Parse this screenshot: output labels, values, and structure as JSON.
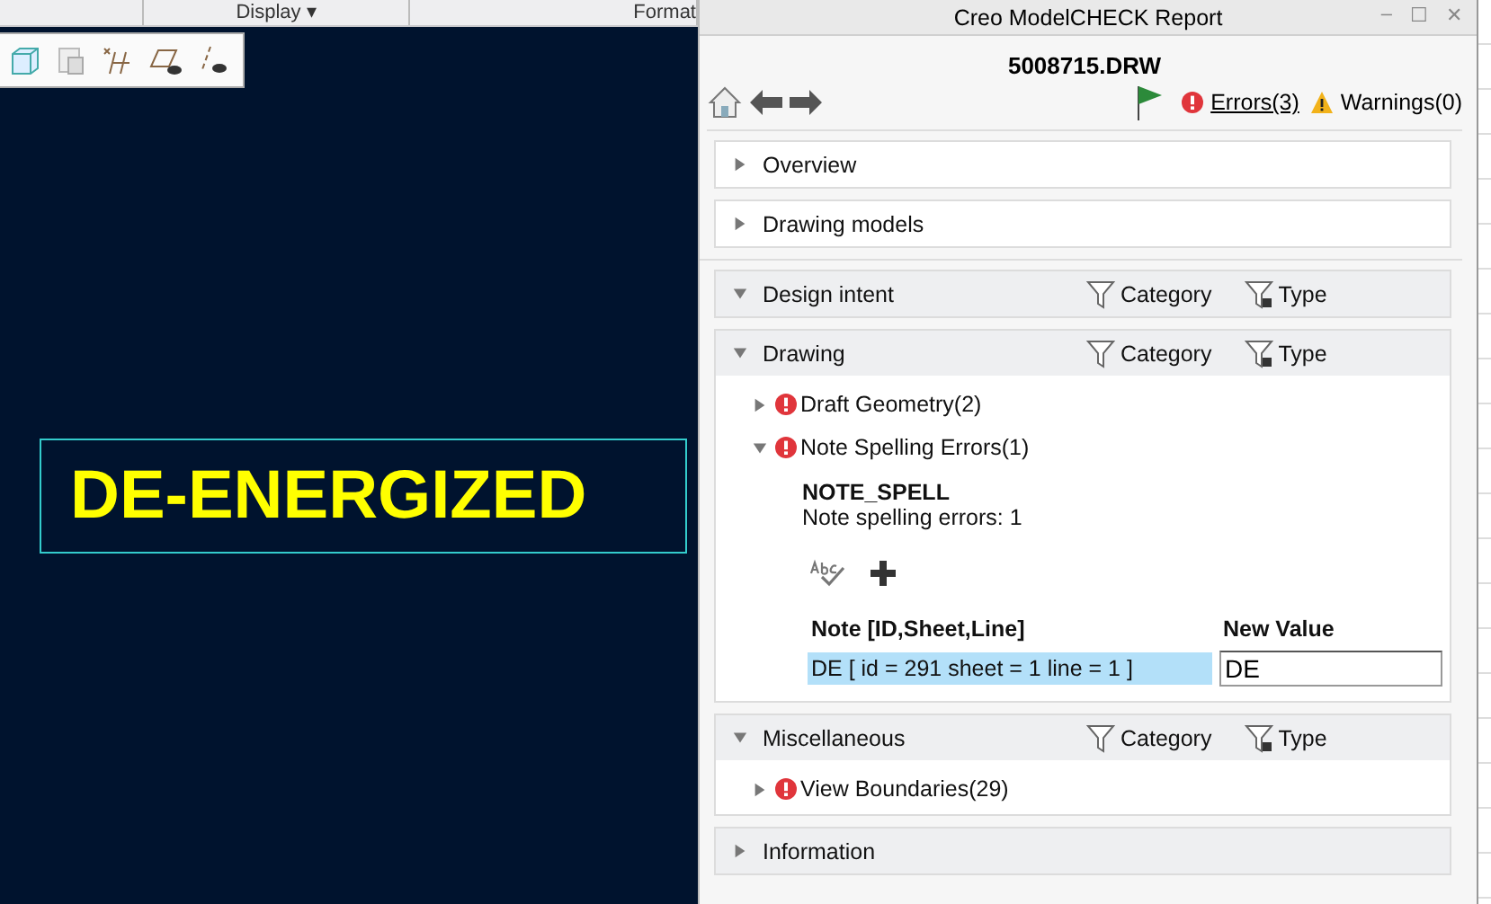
{
  "ribbon": {
    "tabs": [
      {
        "label": "Display",
        "caret": "▾"
      },
      {
        "label": "Format"
      }
    ]
  },
  "canvas": {
    "note": "DE-ENERGIZED"
  },
  "report": {
    "window": {
      "title": "Creo ModelCHECK Report",
      "controls": [
        "–",
        "☐",
        "✕"
      ]
    },
    "filename": "5008715.DRW",
    "errors": "Errors(3)",
    "warnings": "Warnings(0)",
    "sections": [
      {
        "kind": "summary",
        "title": "Overview",
        "expanded": false
      },
      {
        "kind": "summary",
        "title": "Drawing models",
        "expanded": false
      },
      {
        "kind": "category",
        "title": "Design intent",
        "expanded": true,
        "filters": [
          "Category",
          "Type"
        ]
      },
      {
        "kind": "category",
        "title": "Drawing",
        "expanded": true,
        "filters": [
          "Category",
          "Type"
        ],
        "items": [
          {
            "label": "Draft Geometry(2)",
            "expanded": false
          },
          {
            "label": "Note Spelling Errors(1)",
            "expanded": true,
            "detail": {
              "check": "NOTE_SPELL",
              "description": "Note spelling errors: 1",
              "columns": [
                "Note [ID,Sheet,Line]",
                "New Value"
              ],
              "rows": [
                {
                  "note": "DE [ id = 291 sheet = 1 line = 1 ]",
                  "selected": true,
                  "new_value": "DE"
                }
              ]
            }
          }
        ]
      },
      {
        "kind": "category",
        "title": "Miscellaneous",
        "expanded": true,
        "filters": [
          "Category",
          "Type"
        ],
        "items": [
          {
            "label": "View Boundaries(29)",
            "expanded": false
          }
        ]
      },
      {
        "kind": "category",
        "title": "Information",
        "expanded": false
      }
    ]
  }
}
